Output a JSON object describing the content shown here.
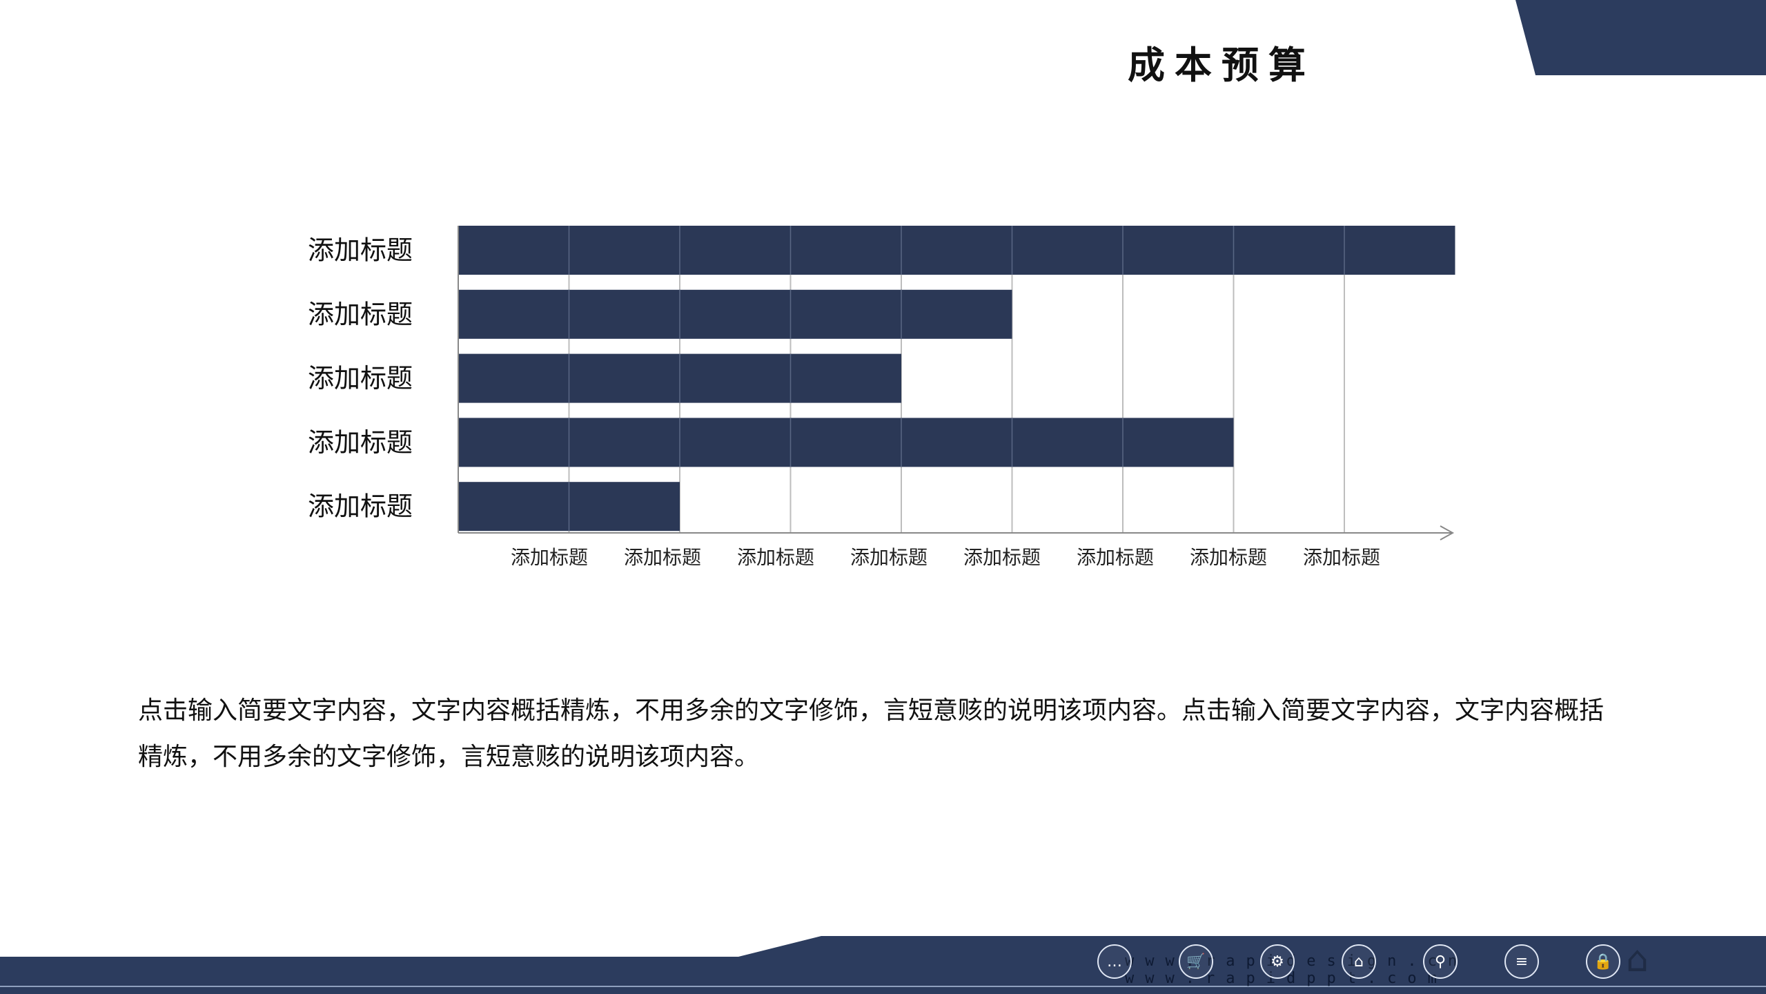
{
  "page": {
    "title": "成本预算",
    "accent_color": "#2c3c5e",
    "bar_color": "#2b3856",
    "description": "点击输入简要文字内容，文字内容概括精炼，不用多余的文字修饰，言短意赅的说明该项内容。点击输入简要文字内容，文字内容概括精炼，不用多余的文字修饰，言短意赅的说明该项内容。"
  },
  "footer": {
    "url_text": "www.rapidesign.cn www.rapidppt.com",
    "icons": [
      "chat-icon",
      "cart-icon",
      "gear-icon",
      "home-icon",
      "search-icon",
      "chart-icon",
      "lock-icon"
    ]
  },
  "chart_data": {
    "type": "bar",
    "orientation": "horizontal",
    "categories": [
      "添加标题",
      "添加标题",
      "添加标题",
      "添加标题",
      "添加标题"
    ],
    "values": [
      9,
      5,
      4,
      7,
      2
    ],
    "x_tick_labels": [
      "添加标题",
      "添加标题",
      "添加标题",
      "添加标题",
      "添加标题",
      "添加标题",
      "添加标题",
      "添加标题"
    ],
    "xlim": [
      0,
      9
    ],
    "grid": true
  }
}
